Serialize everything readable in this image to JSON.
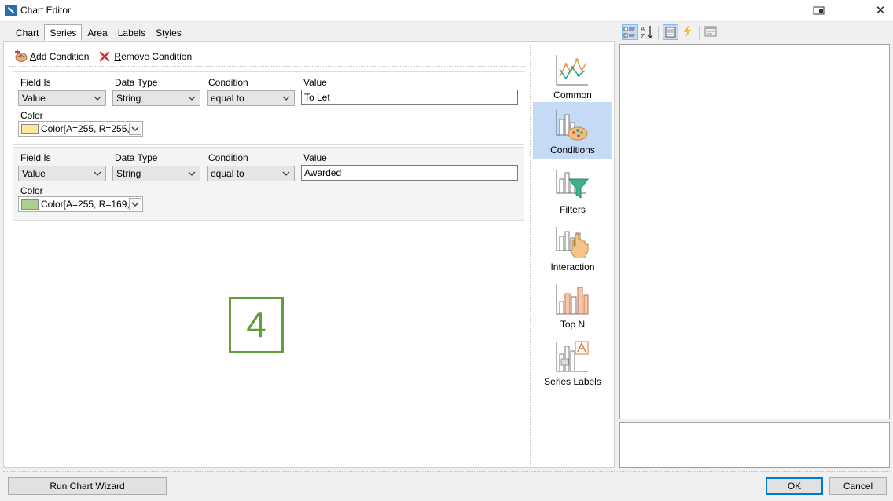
{
  "window": {
    "title": "Chart Editor",
    "close_glyph": "✕"
  },
  "tabs": [
    {
      "label": "Chart",
      "active": false
    },
    {
      "label": "Series",
      "active": true
    },
    {
      "label": "Area",
      "active": false
    },
    {
      "label": "Labels",
      "active": false
    },
    {
      "label": "Styles",
      "active": false
    }
  ],
  "toolbar": {
    "add_condition": {
      "accel": "A",
      "rest": "dd Condition"
    },
    "remove_condition": {
      "accel": "R",
      "rest": "emove Condition"
    }
  },
  "labels": {
    "field_is": "Field Is",
    "data_type": "Data Type",
    "condition": "Condition",
    "value": "Value",
    "color": "Color"
  },
  "conditions": [
    {
      "field_is": "Value",
      "data_type": "String",
      "condition": "equal to",
      "value": "To Let",
      "color_text": "Color[A=255, R=255,",
      "swatch": "#ffe699"
    },
    {
      "field_is": "Value",
      "data_type": "String",
      "condition": "equal to",
      "value": "Awarded",
      "color_text": "Color[A=255, R=169,",
      "swatch": "#a9d08e"
    }
  ],
  "step_number": "4",
  "nav": [
    {
      "label": "Common",
      "icon": "line-chart-icon",
      "selected": false
    },
    {
      "label": "Conditions",
      "icon": "conditions-icon",
      "selected": true
    },
    {
      "label": "Filters",
      "icon": "filter-funnel-icon",
      "selected": false
    },
    {
      "label": "Interaction",
      "icon": "hand-pointer-icon",
      "selected": false
    },
    {
      "label": "Top N",
      "icon": "top-n-bars-icon",
      "selected": false
    },
    {
      "label": "Series Labels",
      "icon": "series-labels-icon",
      "selected": false
    }
  ],
  "buttons": {
    "wizard": "Run Chart Wizard",
    "ok": "OK",
    "cancel": "Cancel"
  },
  "colors": {
    "accent": "#60a03a",
    "selection": "#c4daf7",
    "focus": "#0078d7"
  }
}
